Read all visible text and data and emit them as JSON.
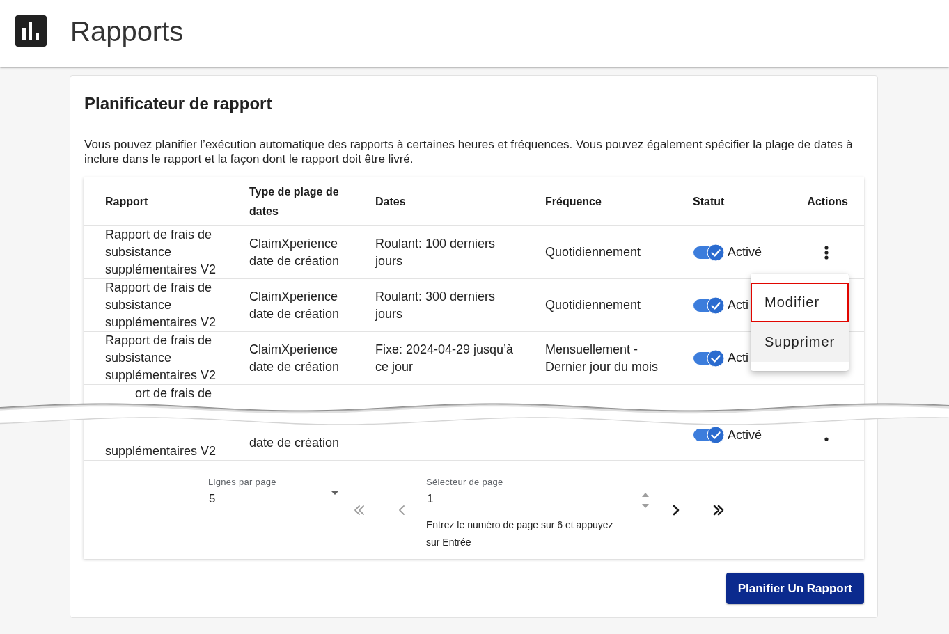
{
  "header": {
    "title": "Rapports"
  },
  "scheduler": {
    "title": "Planificateur de rapport",
    "description": "Vous pouvez planifier l’exécution automatique des rapports à certaines heures et fréquences. Vous pouvez également spécifier la plage de dates à inclure dans le rapport et la façon dont le rapport doit être livré."
  },
  "table": {
    "columns": [
      "Rapport",
      "Type de plage de dates",
      "Dates",
      "Fréquence",
      "Statut",
      "Actions"
    ],
    "rows": [
      {
        "report": "Rapport de frais de subsistance supplémentaires V2",
        "date_type": "ClaimXperience date de création",
        "dates": "Roulant: 100 derniers jours",
        "frequency": "Quotidiennement",
        "status": {
          "on": true,
          "label": "Activé"
        },
        "menu_button": true,
        "menu": {
          "items": [
            {
              "label": "Modifier",
              "highlighted": true,
              "hovered": false
            },
            {
              "label": "Supprimer",
              "highlighted": false,
              "hovered": true
            }
          ]
        }
      },
      {
        "report": "Rapport de frais de subsistance supplémentaires V2",
        "date_type": "ClaimXperience date de création",
        "dates": "Roulant: 300 derniers jours",
        "frequency": "Quotidiennement",
        "status": {
          "on": true,
          "label": "Acti"
        },
        "menu_button": false
      },
      {
        "report": "Rapport de frais de subsistance supplémentaires V2",
        "date_type": "ClaimXperience date de création",
        "dates": "Fixe: 2024-04-29 jusqu’à ce jour",
        "frequency": "Mensuellement - Dernier jour du mois",
        "status": {
          "on": true,
          "label": "Acti"
        },
        "menu_button": false
      }
    ],
    "torn_top": {
      "report": "ort de frais de"
    },
    "torn_bottom": {
      "report": "supplémentaires V2",
      "date_type": "date de création",
      "status": {
        "on": true,
        "label": "Activé"
      }
    }
  },
  "pagination": {
    "rows_per_page": {
      "label": "Lignes par page",
      "value": "5"
    },
    "page_selector": {
      "label": "Sélecteur de page",
      "value": "1",
      "helper": "Entrez le numéro de page sur 6 et appuyez sur Entrée"
    },
    "nav": [
      {
        "kind": "first",
        "disabled": true
      },
      {
        "kind": "previous",
        "disabled": true
      },
      {
        "kind": "next",
        "disabled": false
      },
      {
        "kind": "last",
        "disabled": false
      }
    ]
  },
  "schedule_button": "Planifier Un Rapport"
}
